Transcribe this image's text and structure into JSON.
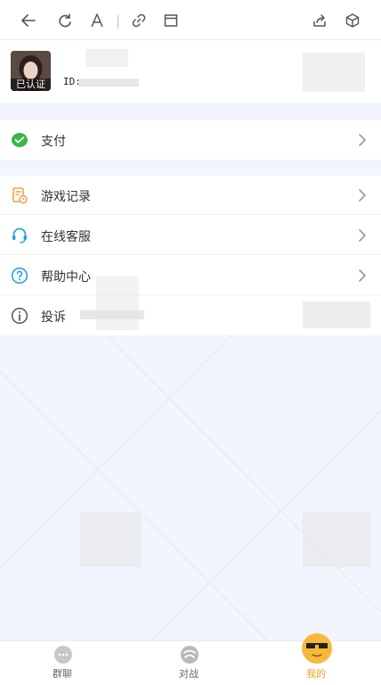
{
  "toolbar": {
    "icons": [
      "back-arrow-icon",
      "refresh-icon",
      "text-size-icon",
      "link-icon",
      "window-icon",
      "share-icon",
      "cube-icon"
    ]
  },
  "profile": {
    "badge": "已认证",
    "id_label": "ID:"
  },
  "menu": {
    "pay": "支付",
    "game_records": "游戏记录",
    "online_service": "在线客服",
    "help_center": "帮助中心",
    "complaint": "投诉"
  },
  "bottom_nav": [
    {
      "label": "群聊",
      "icon": "chat-bubble-icon"
    },
    {
      "label": "对战",
      "icon": "battle-icon"
    },
    {
      "label": "我的",
      "icon": "sunglasses-face-icon"
    }
  ],
  "colors": {
    "background": "#f2f5fd",
    "accent": "#f0a21a",
    "pay_green": "#39b54a",
    "record_orange": "#f5a04a",
    "service_blue": "#29a3e0"
  }
}
